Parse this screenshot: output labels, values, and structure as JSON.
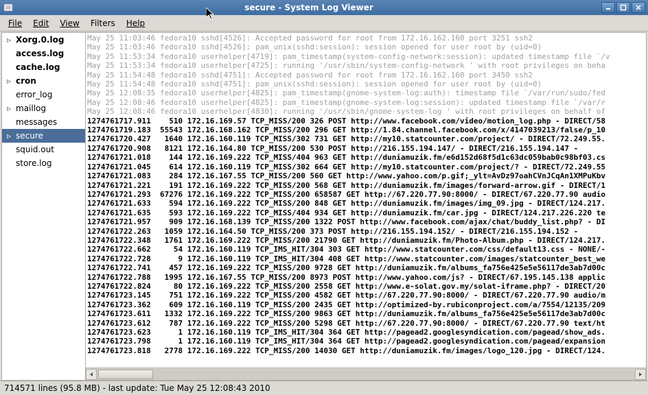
{
  "window": {
    "title": "secure - System Log Viewer",
    "buttons": {
      "min": "minimize",
      "max": "maximize",
      "close": "close"
    }
  },
  "menu": {
    "file": "File",
    "edit": "Edit",
    "view": "View",
    "filters": "Filters",
    "help": "Help"
  },
  "sidebar": {
    "items": [
      {
        "label": "Xorg.0.log",
        "bold": true,
        "expander": "▹",
        "selected": false
      },
      {
        "label": "access.log",
        "bold": true,
        "expander": "",
        "selected": false
      },
      {
        "label": "cache.log",
        "bold": true,
        "expander": "",
        "selected": false
      },
      {
        "label": "cron",
        "bold": true,
        "expander": "▹",
        "selected": false
      },
      {
        "label": "error_log",
        "bold": false,
        "expander": "",
        "selected": false
      },
      {
        "label": "maillog",
        "bold": false,
        "expander": "▹",
        "selected": false
      },
      {
        "label": "messages",
        "bold": false,
        "expander": "",
        "selected": false
      },
      {
        "label": "secure",
        "bold": false,
        "expander": "▹",
        "selected": true
      },
      {
        "label": "squid.out",
        "bold": false,
        "expander": "",
        "selected": false
      },
      {
        "label": "store.log",
        "bold": false,
        "expander": "",
        "selected": false
      }
    ]
  },
  "log": {
    "gray_lines": [
      "May 25 11:03:46 fedora10 sshd[4526]: Accepted password for root from 172.16.162.160 port 3251 ssh2",
      "May 25 11:03:46 fedora10 sshd[4526]: pam_unix(sshd:session): session opened for user root by (uid=0)",
      "May 25 11:53:34 fedora10 userhelper[4719]: pam_timestamp(system-config-network:session): updated timestamp file `/v",
      "May 25 11:53:34 fedora10 userhelper[4725]: running '/usr/sbin/system-config-network ' with root privileges on beha",
      "May 25 11:54:48 fedora10 sshd[4751]: Accepted password for root from 172.16.162.160 port 3450 ssh2",
      "May 25 11:54:48 fedora10 sshd[4751]: pam_unix(sshd:session): session opened for user root by (uid=0)",
      "May 25 12:08:35 fedora10 userhelper[4825]: pam_timestamp(gnome-system-log:auth): timestamp file `/var/run/sudo/fed",
      "May 25 12:08:46 fedora10 userhelper[4825]: pam_timestamp(gnome-system-log:session): updated timestamp file `/var/r",
      "May 25 12:08:46 fedora10 userhelper[4830]: running '/usr/sbin/gnome-system-log ' with root privileges on behalf of"
    ],
    "bold_lines": [
      "1274761717.911    510 172.16.169.57 TCP_MISS/200 326 POST http://www.facebook.com/video/motion_log.php - DIRECT/58",
      "1274761719.183  55543 172.16.168.162 TCP_MISS/200 296 GET http://1.84.channel.facebook.com/x/4147039213/false/p_10",
      "1274761720.427   1640 172.16.160.119 TCP_MISS/302 731 GET http://my10.statcounter.com/project/ - DIRECT/72.249.55.",
      "1274761720.908   8121 172.16.164.80 TCP_MISS/200 530 POST http://216.155.194.147/ - DIRECT/216.155.194.147 -",
      "1274761721.018    144 172.16.169.222 TCP_MISS/404 963 GET http://duniamuzik.fm/e6d152d68f5d1c63dc059bab0c98bf03.cs",
      "1274761721.045    614 172.16.160.119 TCP_MISS/302 664 GET http://my10.statcounter.com/project/? - DIRECT/72.249.55",
      "1274761721.083    284 172.16.167.55 TCP_MISS/200 560 GET http://www.yahoo.com/p.gif;_ylt=AvDz97oahCVnJCqAn1XMPuKbv",
      "1274761721.221    191 172.16.169.222 TCP_MISS/200 568 GET http://duniamuzik.fm/images/forward-arrow.gif - DIRECT/1",
      "1274761721.293  67276 172.16.169.222 TCP_MISS/200 658587 GET http://67.220.77.90:8000/ - DIRECT/67.220.77.90 audio",
      "1274761721.633    594 172.16.169.222 TCP_MISS/200 848 GET http://duniamuzik.fm/images/img_09.jpg - DIRECT/124.217.",
      "1274761721.635    593 172.16.169.222 TCP_MISS/404 934 GET http://duniamuzik.fm/car.jpg - DIRECT/124.217.226.220 te",
      "1274761721.957    909 172.16.168.139 TCP_MISS/200 1322 POST http://www.facebook.com/ajax/chat/buddy_list.php? - DI",
      "1274761722.263   1059 172.16.164.50 TCP_MISS/200 373 POST http://216.155.194.152/ - DIRECT/216.155.194.152 -",
      "1274761722.348   1761 172.16.169.222 TCP_MISS/200 21790 GET http://duniamuzik.fm/Photo-Album.php - DIRECT/124.217.",
      "1274761722.662     54 172.16.160.119 TCP_IMS_HIT/304 303 GET http://www.statcounter.com/css/default13.css - NONE/-",
      "1274761722.728      9 172.16.160.119 TCP_IMS_HIT/304 408 GET http://www.statcounter.com/images/statcounter_best_we",
      "1274761722.741    457 172.16.169.222 TCP_MISS/200 9728 GET http://duniamuzik.fm/albums_fa756e425e5e56117de3ab7d00c",
      "1274761722.788   1995 172.16.167.55 TCP_MISS/200 8973 POST http://www.yahoo.com/js? - DIRECT/67.195.145.138 applic",
      "1274761722.824     80 172.16.169.222 TCP_MISS/200 2558 GET http://www.e-solat.gov.my/solat-iframe.php? - DIRECT/20",
      "1274761723.145    751 172.16.169.222 TCP_MISS/200 4582 GET http://67.220.77.90:8000/ - DIRECT/67.220.77.90 audio/m",
      "1274761723.362    609 172.16.160.119 TCP_MISS/200 2435 GET http://optimized-by.rubiconproject.com/a/7554/12135/209",
      "1274761723.611   1332 172.16.169.222 TCP_MISS/200 9863 GET http://duniamuzik.fm/albums_fa756e425e5e56117de3ab7d00c",
      "1274761723.612    787 172.16.169.222 TCP_MISS/200 5298 GET http://67.220.77.90:8000/ - DIRECT/67.220.77.90 text/ht",
      "1274761723.623      1 172.16.160.119 TCP_IMS_HIT/304 364 GET http://pagead2.googlesyndication.com/pagead/show_ads.",
      "1274761723.798      1 172.16.160.119 TCP_IMS_HIT/304 364 GET http://pagead2.googlesyndication.com/pagead/expansion",
      "1274761723.818   2778 172.16.169.222 TCP_MISS/200 14030 GET http://duniamuzik.fm/images/logo_120.jpg - DIRECT/124."
    ]
  },
  "status": {
    "text": "714571 lines (95.8 MB) - last update: Tue May 25 12:08:43 2010"
  }
}
